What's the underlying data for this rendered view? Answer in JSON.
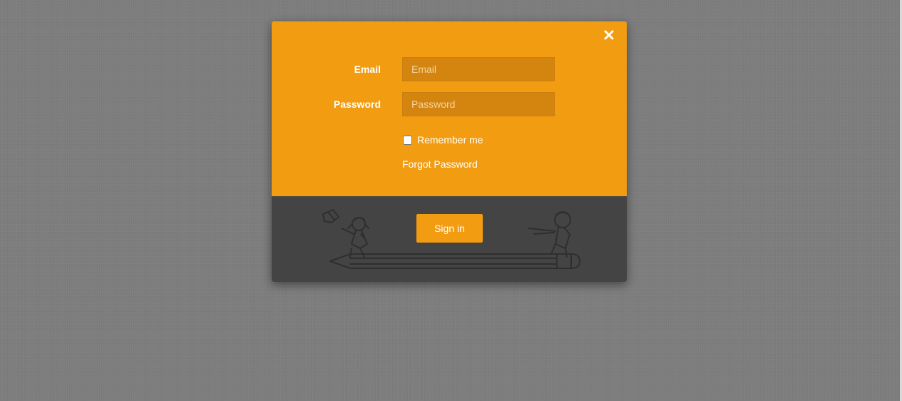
{
  "login_form": {
    "email_label": "Email",
    "email_placeholder": "Email",
    "password_label": "Password",
    "password_placeholder": "Password",
    "remember_label": "Remember me",
    "remember_checked": false,
    "forgot_link": "Forgot Password",
    "signin_label": "Sign in",
    "close_icon": "close-icon"
  },
  "colors": {
    "accent": "#f29c12",
    "input_bg": "#d3850f",
    "footer_bg": "#444444",
    "page_bg": "#7f7f7f"
  }
}
